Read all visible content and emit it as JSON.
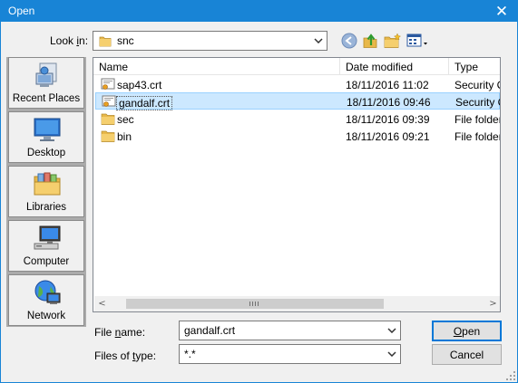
{
  "window": {
    "title": "Open"
  },
  "look_in": {
    "label_pre": "Look ",
    "label_u": "i",
    "label_post": "n:",
    "value": "snc"
  },
  "toolbar": {
    "back_icon": "back-arrow-icon",
    "up_icon": "up-folder-icon",
    "new_folder_icon": "new-folder-icon",
    "view_icon": "view-menu-icon"
  },
  "places": [
    {
      "label": "Recent Places",
      "icon": "recent-places-icon"
    },
    {
      "label": "Desktop",
      "icon": "desktop-icon"
    },
    {
      "label": "Libraries",
      "icon": "libraries-icon"
    },
    {
      "label": "Computer",
      "icon": "computer-icon"
    },
    {
      "label": "Network",
      "icon": "network-icon"
    }
  ],
  "columns": {
    "name": "Name",
    "date": "Date modified",
    "type": "Type"
  },
  "files": [
    {
      "name": "sap43.crt",
      "date": "18/11/2016 11:02",
      "type": "Security C",
      "kind": "certificate",
      "selected": false
    },
    {
      "name": "gandalf.crt",
      "date": "18/11/2016 09:46",
      "type": "Security C",
      "kind": "certificate",
      "selected": true
    },
    {
      "name": "sec",
      "date": "18/11/2016 09:39",
      "type": "File folder",
      "kind": "folder",
      "selected": false
    },
    {
      "name": "bin",
      "date": "18/11/2016 09:21",
      "type": "File folder",
      "kind": "folder",
      "selected": false
    }
  ],
  "file_name": {
    "label_pre": "File ",
    "label_u": "n",
    "label_post": "ame:",
    "value": "gandalf.crt"
  },
  "file_type": {
    "label_pre": "Files of ",
    "label_u": "t",
    "label_post": "ype:",
    "value": "*.*"
  },
  "buttons": {
    "open_u": "O",
    "open_rest": "pen",
    "cancel": "Cancel"
  },
  "colors": {
    "accent": "#1884d6",
    "selection": "#cce8ff",
    "folder": "#e8b84a"
  }
}
